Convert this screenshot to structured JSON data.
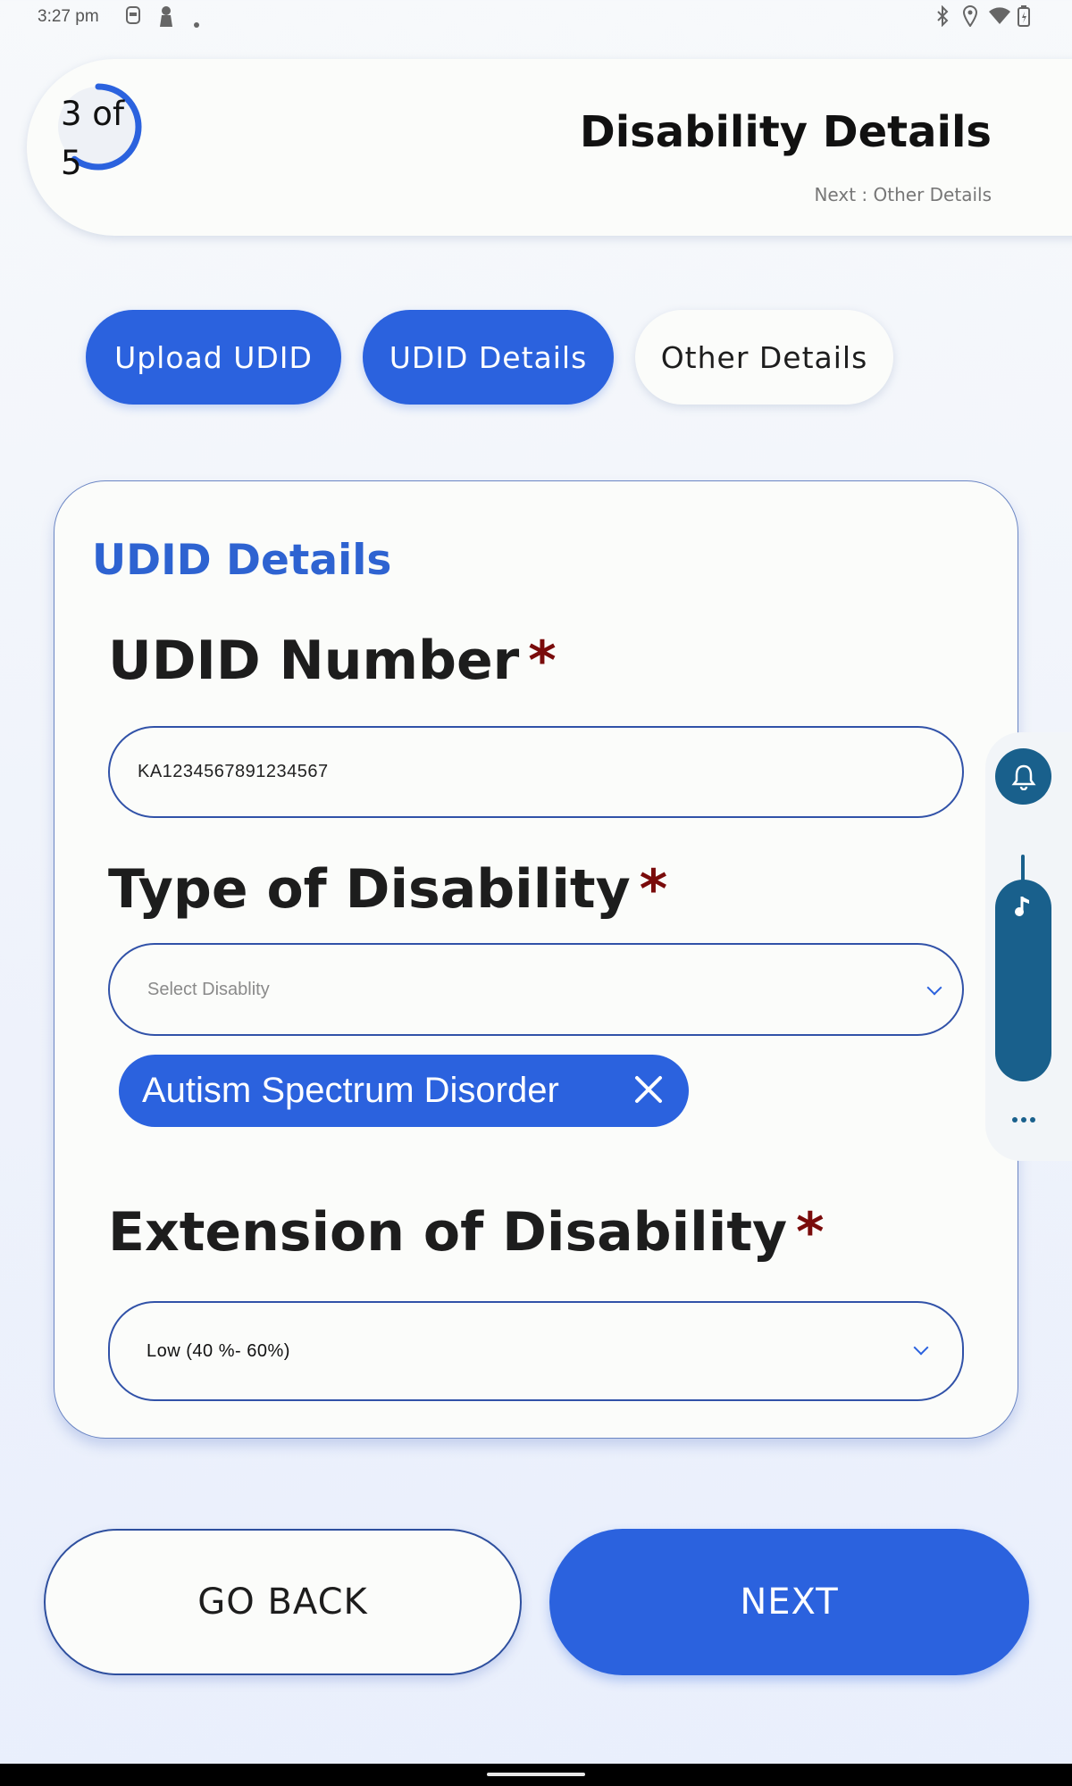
{
  "status_bar": {
    "time": "3:27 pm",
    "icons": [
      "screen-record-icon",
      "person-icon",
      "dot-icon",
      "bluetooth-icon",
      "location-icon",
      "wifi-icon",
      "battery-icon"
    ]
  },
  "header": {
    "progress_text": "3 of 5",
    "progress_line1": "3 of",
    "progress_line2": "5",
    "progress_fraction": 0.6,
    "title": "Disability Details",
    "subtitle": "Next : Other Details"
  },
  "steps": [
    {
      "label": "Upload UDID",
      "active": true
    },
    {
      "label": "UDID Details",
      "active": true
    },
    {
      "label": "Other Details",
      "active": false
    }
  ],
  "form": {
    "card_title": "UDID Details",
    "udid_number": {
      "label": "UDID Number",
      "required_mark": "*",
      "value": "KA1234567891234567"
    },
    "type_of_disability": {
      "label": "Type of Disability",
      "required_mark": "*",
      "placeholder": "Select Disablity",
      "selected_chips": [
        "Autism Spectrum Disorder"
      ]
    },
    "extension_of_disability": {
      "label": "Extension of Disability",
      "required_mark": "*",
      "value": "Low (40 %- 60%)"
    }
  },
  "buttons": {
    "back": "GO BACK",
    "next": "NEXT"
  },
  "colors": {
    "primary": "#2b62de",
    "title_blue": "#2e63d1",
    "required": "#7a0b0b",
    "overlay": "#19608c",
    "background": "#f7f9fb"
  }
}
